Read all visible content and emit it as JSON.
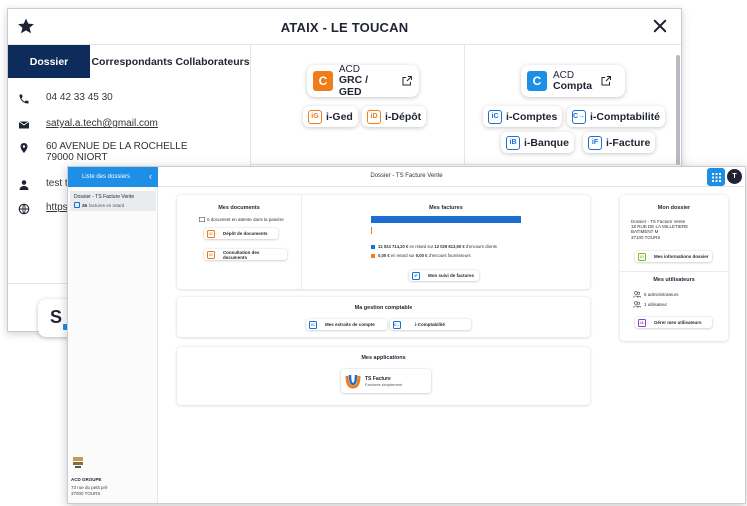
{
  "back_window": {
    "title": "ATAIX - LE TOUCAN",
    "tabs": [
      "Dossier",
      "Correspondants",
      "Collaborateurs"
    ],
    "phone": "04 42 33 45 30",
    "email": "satyal.a.tech@gmail.com",
    "address_line1": "60 AVENUE DE LA ROCHELLE",
    "address_line2": "79000 NIORT",
    "contact_name": "test tc",
    "website": "https:",
    "apps_left": {
      "main_prefix": "ACD",
      "main_name": "GRC / GED",
      "main_letter": "C",
      "pills": [
        {
          "badge": "iG",
          "label": "i-Ged"
        },
        {
          "badge": "iD",
          "label": "i-Dépôt"
        }
      ]
    },
    "apps_right": {
      "main_prefix": "ACD",
      "main_name": "Compta",
      "main_letter": "C",
      "pills": [
        {
          "badge": "iC",
          "label": "i-Comptes"
        },
        {
          "badge": "C→",
          "label": "i-Comptabilité"
        },
        {
          "badge": "iB",
          "label": "i-Banque"
        },
        {
          "badge": "iF",
          "label": "i-Facture"
        }
      ]
    },
    "logo_letter": "S"
  },
  "front_window": {
    "list_button": "Liste des dossiers",
    "title": "Dossier - TS Facture Vente",
    "avatar": "T",
    "sidebar": {
      "item_name": "Dossier - TS Facture Vente",
      "item_count": "26",
      "item_count_label": "factures en retard",
      "org_name": "ACD GROUPE",
      "org_addr1": "73 rue du petit pré",
      "org_addr2": "37000 TOURS"
    },
    "mes_documents": {
      "title": "Mes documents",
      "pending": "0 document en attente dans la panière",
      "btn_depot": "Dépôt de documents",
      "btn_consult": "Consultation des documents"
    },
    "mes_factures": {
      "title": "Mes factures",
      "legend_clients_amount": "12 024 714,20 €",
      "legend_clients_mid": "en retard sur",
      "legend_clients_total": "12 029 613,50 €",
      "legend_clients_tail": "d'encours clients",
      "legend_fourn_amount": "0,00 €",
      "legend_fourn_mid": "en retard sur",
      "legend_fourn_total": "0,00 €",
      "legend_fourn_tail": "d'encours fournisseurs",
      "btn_suivi": "Mon suivi de factures",
      "retard_clients": 12024714.2,
      "encours_clients": 12029613.5,
      "retard_fournisseurs": 0.0,
      "encours_fournisseurs": 0.0
    },
    "gestion": {
      "title": "Ma gestion comptable",
      "btn_extraits": "Mes extraits de compte",
      "btn_compta": "i-Comptabilité"
    },
    "applications": {
      "title": "Mes applications",
      "app_name": "TS Facture",
      "app_tagline": "Factures simplement"
    },
    "mon_dossier": {
      "title": "Mon dossier",
      "lines": [
        "Dossier - TS Facture Vente",
        "18 RUE DE LA MILLETIERE",
        "BATIMENT M",
        "37100 TOURS"
      ],
      "btn_infos": "Mes informations dossier"
    },
    "mes_utilisateurs": {
      "title": "Mes utilisateurs",
      "admins": "5 administrateurs",
      "users": "1 utilisateur",
      "btn_gerer": "Gérer mes utilisateurs"
    }
  },
  "colors": {
    "accent_blue": "#1d8fe6",
    "navy": "#0d2c5c",
    "orange": "#ef7d1a",
    "bar_blue": "#1d6fcf"
  }
}
